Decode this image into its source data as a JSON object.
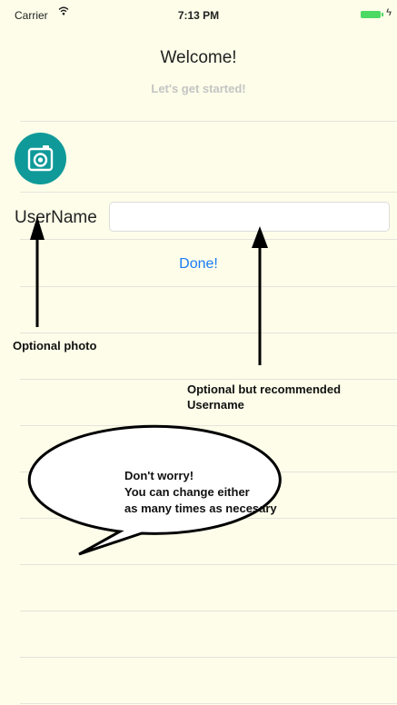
{
  "status_bar": {
    "carrier": "Carrier",
    "time": "7:13 PM",
    "battery_color": "#4cd964"
  },
  "header": {
    "title": "Welcome!",
    "subtitle": "Let's get started!"
  },
  "profile": {
    "photo_icon": "camera-icon",
    "accent_color": "#0f9a99"
  },
  "form": {
    "username_label": "UserName",
    "username_value": "",
    "username_placeholder": "",
    "done_label": "Done!",
    "done_color": "#1a7cf5"
  },
  "annotations": {
    "photo_note": "Optional photo",
    "username_note_line1": "Optional but recommended",
    "username_note_line2": "Username",
    "bubble_line1": "Don't worry!",
    "bubble_line2": "You can change either",
    "bubble_line3": "as many times as necesary"
  }
}
